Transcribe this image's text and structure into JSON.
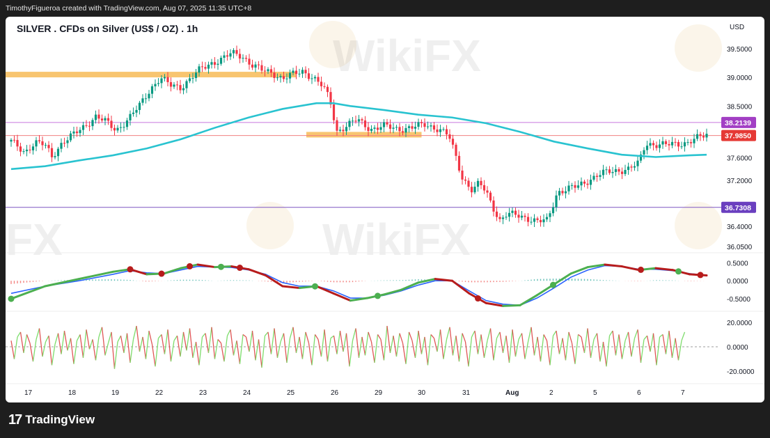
{
  "header": {
    "credit": "TimothyFigueroa created with TradingView.com, Aug 07, 2025 11:35 UTC+8"
  },
  "footer": {
    "logo_icon": "tradingview-logo-icon",
    "brand": "TradingView"
  },
  "watermark": {
    "text": "WikiFX",
    "fragment": "FX"
  },
  "colors": {
    "up": "#089981",
    "down": "#f23645",
    "ma": "#29c3d0",
    "zone": "#f5a623",
    "level_purple": "#9c27b0",
    "macd_green": "#4caf50",
    "macd_red": "#b71c1c",
    "macd_blue": "#2962ff",
    "osc_green": "#7ddc6b",
    "osc_red": "#e05555"
  },
  "chart_data": [
    {
      "type": "candlestick",
      "title": "SILVER . CFDs on Silver (US$ / OZ) . 1h",
      "currency": "USD",
      "ylim": [
        35.95,
        39.72
      ],
      "yticks": [
        39.5,
        39.0,
        38.5,
        37.6,
        37.2,
        36.4,
        36.05
      ],
      "ytick_labels": [
        "39.5000",
        "39.0000",
        "38.5000",
        "37.6000",
        "37.2000",
        "36.4000",
        "36.0500"
      ],
      "xticks": [
        "17",
        "18",
        "19",
        "22",
        "23",
        "24",
        "25",
        "26",
        "29",
        "30",
        "31",
        "Aug",
        "2",
        "5",
        "6",
        "7"
      ],
      "close_path": [
        [
          0,
          37.88
        ],
        [
          4,
          37.7
        ],
        [
          7,
          37.86
        ],
        [
          10,
          37.82
        ],
        [
          12,
          37.62
        ],
        [
          15,
          37.86
        ],
        [
          18,
          37.98
        ],
        [
          21,
          38.12
        ],
        [
          25,
          38.32
        ],
        [
          28,
          38.22
        ],
        [
          31,
          38.08
        ],
        [
          35,
          38.3
        ],
        [
          38,
          38.52
        ],
        [
          41,
          38.8
        ],
        [
          44,
          38.99
        ],
        [
          47,
          38.86
        ],
        [
          50,
          38.83
        ],
        [
          53,
          38.99
        ],
        [
          56,
          39.15
        ],
        [
          59,
          39.25
        ],
        [
          62,
          39.32
        ],
        [
          65,
          39.42
        ],
        [
          68,
          39.38
        ],
        [
          71,
          39.22
        ],
        [
          74,
          39.12
        ],
        [
          77,
          39.08
        ],
        [
          80,
          38.98
        ],
        [
          83,
          39.05
        ],
        [
          86,
          39.11
        ],
        [
          89,
          39.0
        ],
        [
          92,
          38.83
        ],
        [
          94,
          38.6
        ],
        [
          96,
          38.06
        ],
        [
          99,
          38.16
        ],
        [
          102,
          38.26
        ],
        [
          106,
          38.1
        ],
        [
          110,
          38.15
        ],
        [
          114,
          38.1
        ],
        [
          118,
          38.12
        ],
        [
          122,
          38.18
        ],
        [
          126,
          38.1
        ],
        [
          129,
          37.98
        ],
        [
          131,
          37.63
        ],
        [
          133,
          37.25
        ],
        [
          136,
          37.02
        ],
        [
          138,
          37.15
        ],
        [
          140,
          37.0
        ],
        [
          142,
          36.75
        ],
        [
          144,
          36.5
        ],
        [
          146,
          36.6
        ],
        [
          149,
          36.6
        ],
        [
          152,
          36.55
        ],
        [
          155,
          36.48
        ],
        [
          158,
          36.5
        ],
        [
          161,
          37.0
        ],
        [
          164,
          37.05
        ],
        [
          167,
          37.1
        ],
        [
          170,
          37.2
        ],
        [
          173,
          37.3
        ],
        [
          176,
          37.35
        ],
        [
          179,
          37.38
        ],
        [
          182,
          37.4
        ],
        [
          185,
          37.5
        ],
        [
          187,
          37.85
        ],
        [
          190,
          37.83
        ],
        [
          193,
          37.82
        ],
        [
          196,
          37.84
        ],
        [
          199,
          37.86
        ],
        [
          202,
          37.93
        ],
        [
          205,
          38.0
        ]
      ],
      "ma_line": {
        "label": "moving-average",
        "points": [
          [
            0,
            37.4
          ],
          [
            10,
            37.45
          ],
          [
            20,
            37.55
          ],
          [
            30,
            37.64
          ],
          [
            40,
            37.76
          ],
          [
            50,
            37.92
          ],
          [
            60,
            38.12
          ],
          [
            70,
            38.3
          ],
          [
            80,
            38.45
          ],
          [
            90,
            38.55
          ],
          [
            95,
            38.55
          ],
          [
            100,
            38.5
          ],
          [
            110,
            38.43
          ],
          [
            120,
            38.35
          ],
          [
            130,
            38.3
          ],
          [
            140,
            38.2
          ],
          [
            150,
            38.05
          ],
          [
            160,
            37.88
          ],
          [
            170,
            37.76
          ],
          [
            180,
            37.65
          ],
          [
            190,
            37.61
          ],
          [
            200,
            37.64
          ],
          [
            205,
            37.65
          ]
        ]
      },
      "levels": [
        {
          "label": "38.2139",
          "value": 38.2139,
          "color": "#c678dd",
          "badge": "#a23fc4"
        },
        {
          "label": "37.9850",
          "value": 37.985,
          "color": "#f08080",
          "badge": "#e53935"
        },
        {
          "label": "36.7308",
          "value": 36.7308,
          "color": "#7e57c2",
          "badge": "#6a3fbf"
        }
      ],
      "zones": [
        {
          "x0": 0,
          "x1": 91,
          "value": 39.05
        },
        {
          "x0": 96,
          "x1": 131,
          "value": 38.0
        }
      ]
    },
    {
      "type": "line",
      "indicator": "macd",
      "ylim": [
        -0.75,
        0.72
      ],
      "yticks": [
        0.5,
        0.0,
        -0.5
      ],
      "ytick_labels": [
        "0.5000",
        "0.0000",
        "-0.5000"
      ],
      "fast": [
        [
          0,
          -0.5
        ],
        [
          10,
          -0.15
        ],
        [
          20,
          0.05
        ],
        [
          30,
          0.25
        ],
        [
          35,
          0.32
        ],
        [
          40,
          0.18
        ],
        [
          45,
          0.2
        ],
        [
          50,
          0.35
        ],
        [
          55,
          0.45
        ],
        [
          60,
          0.38
        ],
        [
          65,
          0.4
        ],
        [
          70,
          0.32
        ],
        [
          75,
          0.15
        ],
        [
          80,
          -0.15
        ],
        [
          85,
          -0.2
        ],
        [
          90,
          -0.15
        ],
        [
          95,
          -0.35
        ],
        [
          100,
          -0.55
        ],
        [
          105,
          -0.48
        ],
        [
          110,
          -0.38
        ],
        [
          115,
          -0.25
        ],
        [
          120,
          -0.05
        ],
        [
          125,
          0.05
        ],
        [
          130,
          0.0
        ],
        [
          135,
          -0.35
        ],
        [
          140,
          -0.62
        ],
        [
          145,
          -0.7
        ],
        [
          150,
          -0.68
        ],
        [
          155,
          -0.4
        ],
        [
          160,
          -0.1
        ],
        [
          165,
          0.2
        ],
        [
          170,
          0.38
        ],
        [
          175,
          0.45
        ],
        [
          180,
          0.4
        ],
        [
          185,
          0.3
        ],
        [
          190,
          0.35
        ],
        [
          195,
          0.3
        ],
        [
          200,
          0.18
        ],
        [
          205,
          0.15
        ]
      ],
      "slow": [
        [
          0,
          -0.35
        ],
        [
          10,
          -0.15
        ],
        [
          20,
          0.0
        ],
        [
          30,
          0.18
        ],
        [
          35,
          0.28
        ],
        [
          40,
          0.22
        ],
        [
          45,
          0.2
        ],
        [
          50,
          0.3
        ],
        [
          55,
          0.4
        ],
        [
          60,
          0.38
        ],
        [
          65,
          0.37
        ],
        [
          70,
          0.3
        ],
        [
          75,
          0.18
        ],
        [
          80,
          -0.05
        ],
        [
          85,
          -0.15
        ],
        [
          90,
          -0.15
        ],
        [
          95,
          -0.28
        ],
        [
          100,
          -0.48
        ],
        [
          105,
          -0.48
        ],
        [
          110,
          -0.4
        ],
        [
          115,
          -0.28
        ],
        [
          120,
          -0.12
        ],
        [
          125,
          0.0
        ],
        [
          130,
          0.0
        ],
        [
          135,
          -0.28
        ],
        [
          140,
          -0.55
        ],
        [
          145,
          -0.65
        ],
        [
          150,
          -0.68
        ],
        [
          155,
          -0.48
        ],
        [
          160,
          -0.2
        ],
        [
          165,
          0.1
        ],
        [
          170,
          0.3
        ],
        [
          175,
          0.42
        ],
        [
          180,
          0.4
        ],
        [
          185,
          0.32
        ],
        [
          190,
          0.32
        ],
        [
          195,
          0.28
        ],
        [
          200,
          0.2
        ],
        [
          205,
          0.15
        ]
      ],
      "cross_marks": [
        {
          "x": 0,
          "kind": "up"
        },
        {
          "x": 38,
          "kind": "down"
        },
        {
          "x": 48,
          "kind": "down"
        },
        {
          "x": 57,
          "kind": "down"
        },
        {
          "x": 67,
          "kind": "up"
        },
        {
          "x": 73,
          "kind": "down"
        },
        {
          "x": 97,
          "kind": "up"
        },
        {
          "x": 117,
          "kind": "up"
        },
        {
          "x": 149,
          "kind": "down"
        },
        {
          "x": 173,
          "kind": "up"
        },
        {
          "x": 201,
          "kind": "down"
        },
        {
          "x": 213,
          "kind": "up"
        },
        {
          "x": 220,
          "kind": "down"
        }
      ]
    },
    {
      "type": "line",
      "indicator": "oscillator",
      "ylim": [
        -25,
        25
      ],
      "yticks": [
        20,
        0,
        -20
      ],
      "ytick_labels": [
        "20.0000",
        "0.0000",
        "-20.0000"
      ],
      "values": [
        5,
        -10,
        8,
        12,
        -5,
        10,
        3,
        -12,
        6,
        15,
        -8,
        4,
        9,
        -15,
        2,
        11,
        -6,
        13,
        -3,
        7,
        -14,
        5,
        10,
        -9,
        14,
        -2,
        6,
        -11,
        8,
        16,
        -7,
        3,
        12,
        -18,
        4,
        9,
        -5,
        11,
        -13,
        6,
        17,
        -4,
        8,
        -10,
        13,
        2,
        -16,
        7,
        10,
        -6,
        14,
        -12,
        5,
        9,
        -8,
        12,
        -3,
        15,
        -9,
        4,
        -15,
        8,
        11,
        -5,
        16,
        -10,
        6,
        3,
        -12,
        9,
        14,
        -7,
        5,
        -14,
        10,
        8,
        -4,
        13,
        -11,
        6,
        -17,
        9,
        12,
        -6,
        15,
        -9,
        4,
        11,
        -13,
        7,
        16,
        -5,
        8,
        -10,
        12,
        3,
        -15,
        10,
        6,
        -8,
        14,
        -12,
        7,
        9,
        -6,
        13,
        -4,
        11,
        -16,
        5,
        15,
        -9,
        8,
        -7,
        12,
        4,
        -13,
        10,
        6,
        -11,
        17,
        -5,
        9,
        -8,
        11,
        3,
        -14,
        12,
        5,
        -9,
        13,
        -6,
        8,
        -15,
        10,
        7,
        -4,
        14,
        -10,
        6,
        16,
        -7,
        9,
        -12,
        11,
        4,
        -16,
        8,
        13,
        -6,
        10,
        -9,
        5,
        15,
        -11,
        7,
        12,
        -5,
        9,
        -13,
        14,
        -8,
        6,
        11,
        -10,
        4,
        16,
        -7,
        8,
        -12,
        10,
        5,
        -15,
        9,
        13,
        -6,
        7,
        -11,
        12,
        3,
        -14,
        10,
        8,
        -5,
        15,
        -9,
        6,
        11,
        -12,
        4,
        -16,
        9,
        13,
        -7,
        10,
        -10,
        5,
        12,
        -8,
        7,
        14,
        -13,
        6,
        9,
        -4,
        11,
        -15,
        8,
        10,
        -6,
        13,
        -9,
        7,
        -11,
        5,
        12
      ]
    }
  ]
}
